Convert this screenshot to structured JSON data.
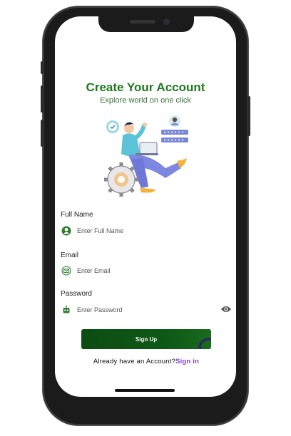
{
  "header": {
    "title": "Create Your Account",
    "subtitle": "Explore world on one click"
  },
  "form": {
    "full_name": {
      "label": "Full Name",
      "placeholder": "Enter Full Name",
      "icon": "user-icon"
    },
    "email": {
      "label": "Email",
      "placeholder": "Enter Email",
      "icon": "email-icon"
    },
    "password": {
      "label": "Password",
      "placeholder": "Enter Password",
      "icon": "robot-icon",
      "toggle_icon": "eye-icon"
    }
  },
  "actions": {
    "signup_label": "Sign Up",
    "signin_prompt": "Already have an Account?",
    "signin_link": "Sign in"
  },
  "colors": {
    "title": "#1f7a1f",
    "button": "#0f5a17",
    "link": "#7b3fd1"
  }
}
